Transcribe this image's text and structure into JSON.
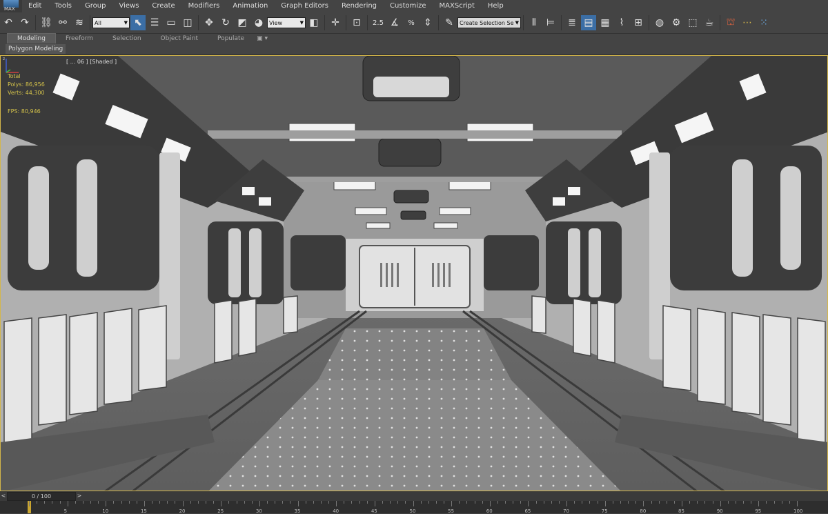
{
  "app": {
    "logo_text": "MAX"
  },
  "menu": [
    "Edit",
    "Tools",
    "Group",
    "Views",
    "Create",
    "Modifiers",
    "Animation",
    "Graph Editors",
    "Rendering",
    "Customize",
    "MAXScript",
    "Help"
  ],
  "toolbar": {
    "selection_filter": "All",
    "reference_coordinate": "View",
    "named_selection_placeholder": "Create Selection Se",
    "snap_2d_label": "2.5",
    "percent_snap_label": "%"
  },
  "ribbon": {
    "tabs": [
      "Modeling",
      "Freeform",
      "Selection",
      "Object Paint",
      "Populate"
    ],
    "active_tab": "Modeling",
    "panel_label": "Polygon Modeling"
  },
  "viewport": {
    "label": "[ ... 06 ] [Shaded ]",
    "stats": [
      {
        "label": "Total",
        "value": ""
      },
      {
        "label": "Polys:",
        "value": "86,956"
      },
      {
        "label": "Verts:",
        "value": "44,300"
      }
    ],
    "fps_label": "FPS:",
    "fps_value": "80,946"
  },
  "timeline": {
    "frame_display": "0 / 100",
    "prev": "<",
    "next": ">",
    "ticks": [
      5,
      10,
      15,
      20,
      25,
      30,
      35,
      40,
      45,
      50,
      55,
      60,
      65,
      70,
      75,
      80,
      85,
      90,
      95,
      100
    ],
    "current_frame": 0
  },
  "colors": {
    "viewport_border": "#d4b64a",
    "stats_text": "#d4c24a",
    "active_tool": "#3b6ea5"
  }
}
